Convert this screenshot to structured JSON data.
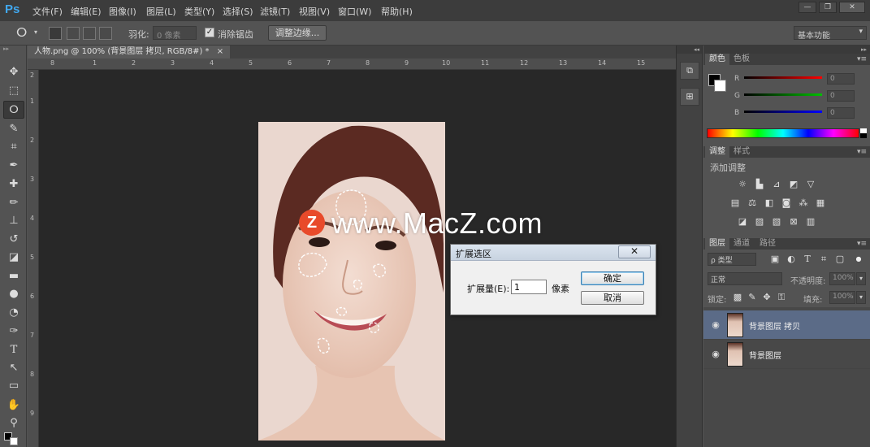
{
  "app": {
    "logo": "Ps"
  },
  "menu": [
    {
      "label": "文件(F)"
    },
    {
      "label": "编辑(E)"
    },
    {
      "label": "图像(I)"
    },
    {
      "label": "图层(L)"
    },
    {
      "label": "类型(Y)"
    },
    {
      "label": "选择(S)"
    },
    {
      "label": "滤镜(T)"
    },
    {
      "label": "视图(V)"
    },
    {
      "label": "窗口(W)"
    },
    {
      "label": "帮助(H)"
    }
  ],
  "window_controls": {
    "minimize": "—",
    "restore": "❐",
    "close": "✕"
  },
  "options_bar": {
    "tool_icon": "lasso-icon",
    "feather_label": "羽化:",
    "feather_value": "0 像素",
    "antialias_label": "消除锯齿",
    "antialias_checked": "✓",
    "refine_edge_button": "调整边缘...",
    "workspace": "基本功能",
    "workspace_arrow": "▾"
  },
  "document": {
    "tab_title": "人物.png @ 100% (背景图层 拷贝, RGB/8#) *",
    "tab_close": "×",
    "ruler_top": [
      "8",
      "1",
      "2",
      "3",
      "4",
      "5",
      "6",
      "7",
      "8",
      "9",
      "10",
      "11",
      "12",
      "13",
      "14",
      "15"
    ],
    "ruler_left": [
      "2",
      "1",
      "2",
      "3",
      "4",
      "5",
      "6",
      "7",
      "8",
      "9",
      "10"
    ]
  },
  "watermark": {
    "logo": "Z",
    "text": "www.MacZ.com"
  },
  "dialog": {
    "title": "扩展选区",
    "close": "✕",
    "label": "扩展量(E):",
    "value": "1",
    "unit": "像素",
    "ok": "确定",
    "cancel": "取消"
  },
  "panels": {
    "color": {
      "tabs": [
        "颜色",
        "色板"
      ],
      "channels": [
        {
          "label": "R",
          "value": "0",
          "color": "#ff0000"
        },
        {
          "label": "G",
          "value": "0",
          "color": "#00c000"
        },
        {
          "label": "B",
          "value": "0",
          "color": "#0000ff"
        }
      ],
      "foreground": "#000000",
      "background": "#ffffff"
    },
    "adjustments": {
      "tabs": [
        "调整",
        "样式"
      ],
      "title": "添加调整"
    },
    "layers": {
      "tabs": [
        "图层",
        "通道",
        "路径"
      ],
      "filter_kind": "ρ 类型",
      "blend_mode": "正常",
      "opacity_label": "不透明度:",
      "opacity_value": "100%",
      "lock_label": "锁定:",
      "fill_label": "填充:",
      "fill_value": "100%",
      "items": [
        {
          "name": "背景图层 拷贝",
          "selected": true
        },
        {
          "name": "背景图层",
          "selected": false
        }
      ]
    }
  },
  "panel_menu_glyph": "▾≡"
}
